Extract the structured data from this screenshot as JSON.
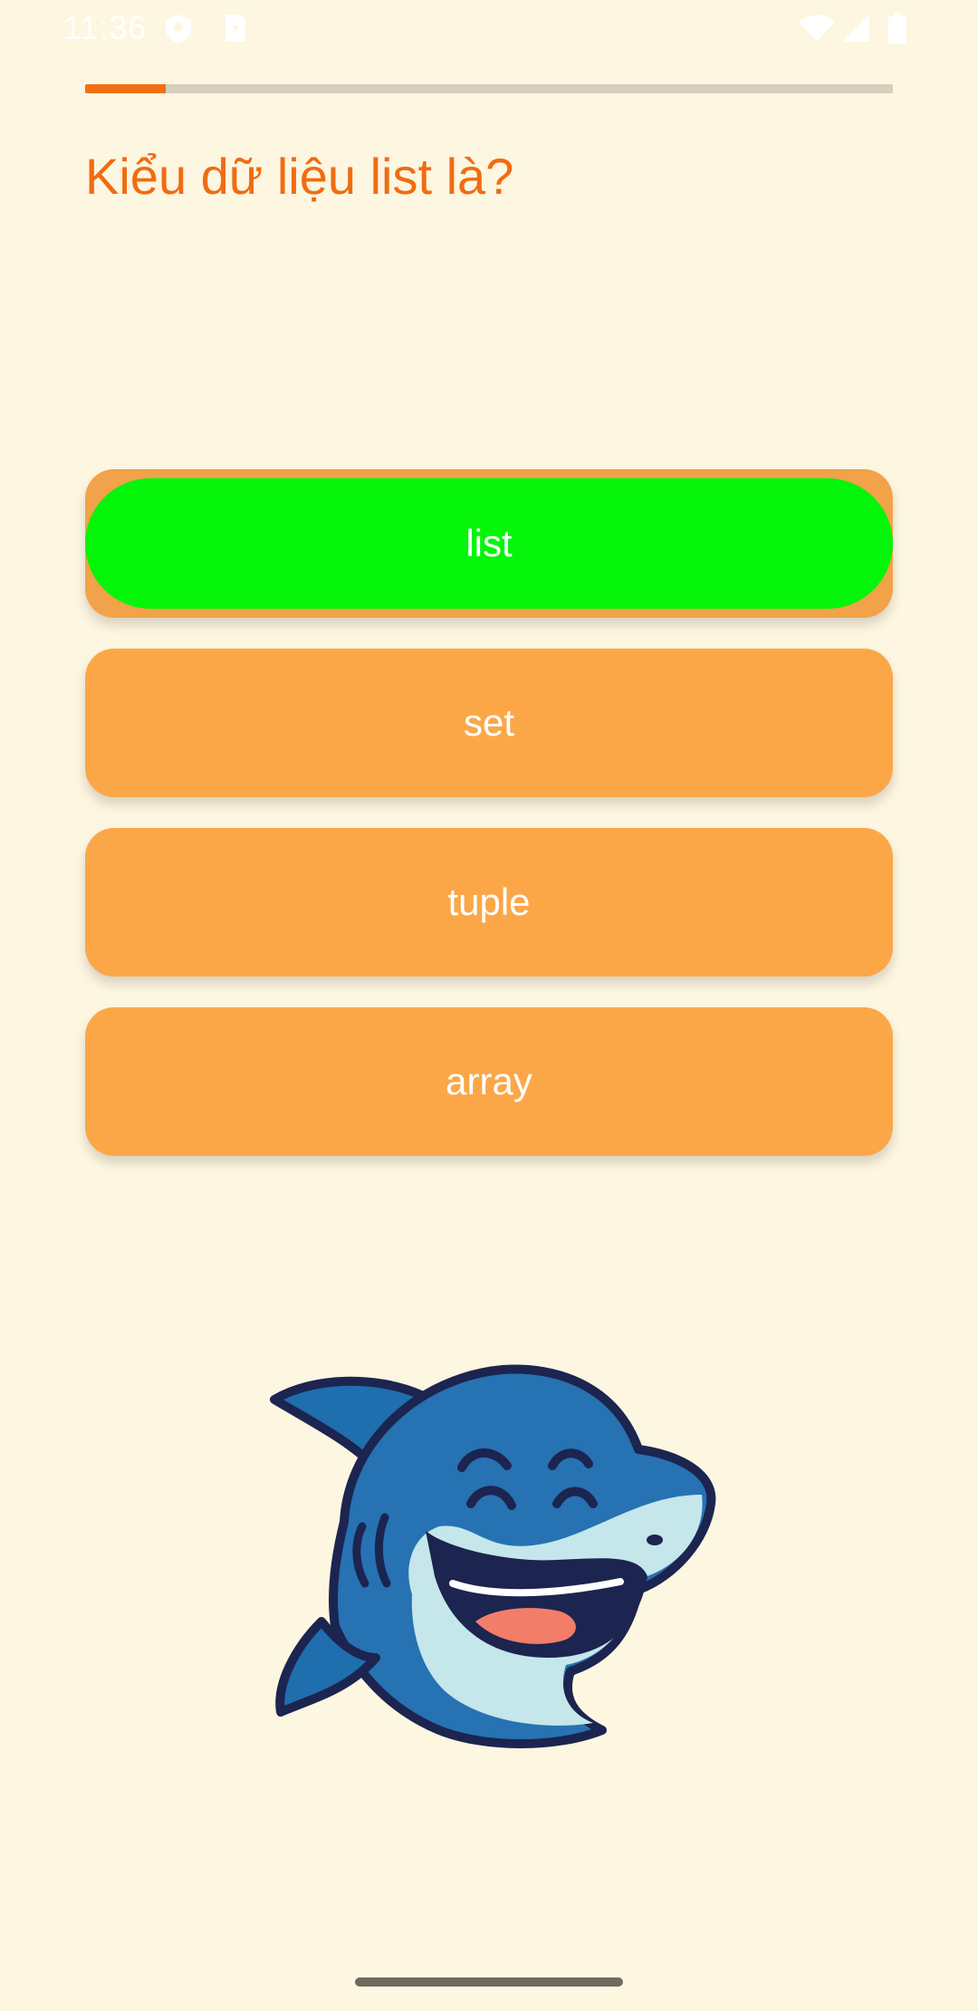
{
  "status_bar": {
    "time": "11:36"
  },
  "quiz": {
    "progress": 0.1,
    "question": "Kiểu dữ liệu list là?",
    "answers": [
      {
        "label": "list",
        "state": "correct"
      },
      {
        "label": "set",
        "state": "default"
      },
      {
        "label": "tuple",
        "state": "default"
      },
      {
        "label": "array",
        "state": "default"
      }
    ]
  },
  "colors": {
    "background": "#fdf6e0",
    "accent": "#f06c12",
    "answer_button": "#fba748",
    "correct": "#05f50a"
  },
  "icons": [
    "shield-icon",
    "sim-card-icon",
    "wifi-icon",
    "signal-icon",
    "battery-icon"
  ]
}
